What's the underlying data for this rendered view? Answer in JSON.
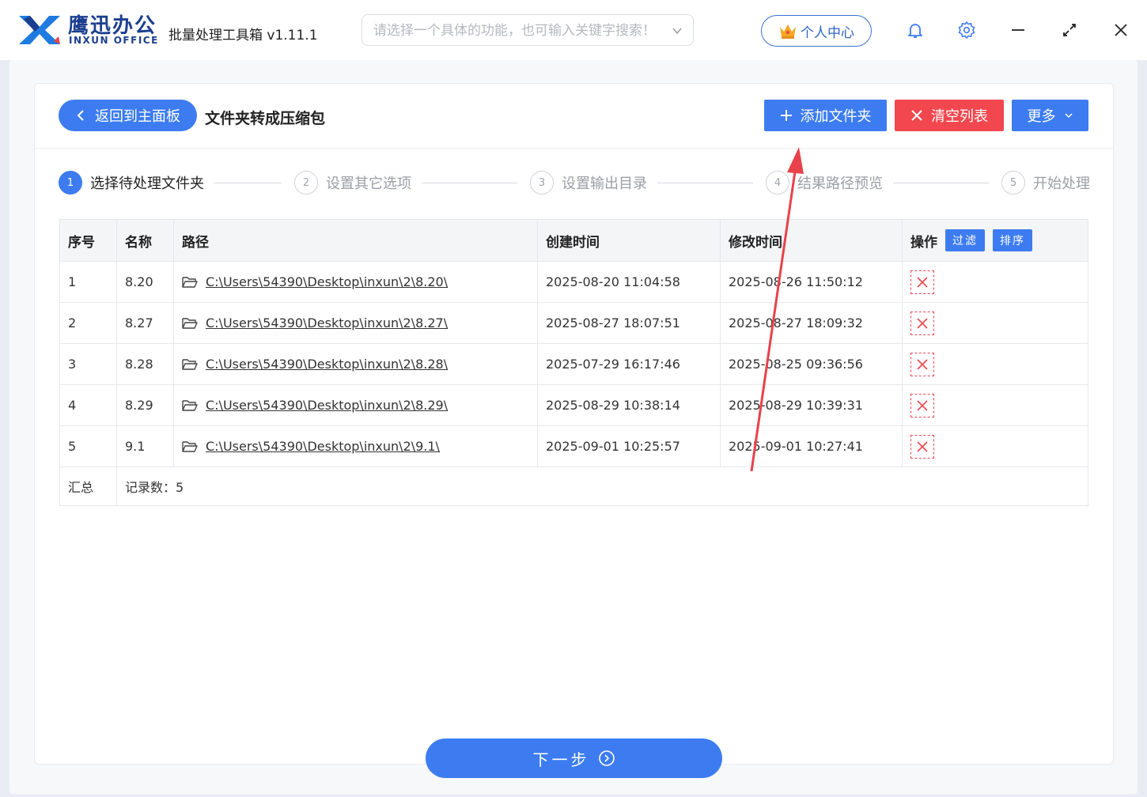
{
  "brand": {
    "name_cn": "鹰迅办公",
    "name_en": "INXUN OFFICE"
  },
  "app": {
    "title": "批量处理工具箱 v1.11.1"
  },
  "search": {
    "placeholder": "请选择一个具体的功能，也可输入关键字搜索！"
  },
  "header": {
    "user_center_label": "个人中心"
  },
  "toolbar": {
    "back_label": "返回到主面板",
    "page_title": "文件夹转成压缩包",
    "add_folder_label": "添加文件夹",
    "clear_list_label": "清空列表",
    "more_label": "更多"
  },
  "steps": [
    {
      "num": "1",
      "label": "选择待处理文件夹"
    },
    {
      "num": "2",
      "label": "设置其它选项"
    },
    {
      "num": "3",
      "label": "设置输出目录"
    },
    {
      "num": "4",
      "label": "结果路径预览"
    },
    {
      "num": "5",
      "label": "开始处理"
    }
  ],
  "table": {
    "headers": {
      "no": "序号",
      "name": "名称",
      "path": "路径",
      "created": "创建时间",
      "modified": "修改时间",
      "op": "操作",
      "filter": "过滤",
      "sort": "排序"
    },
    "rows": [
      {
        "no": "1",
        "name": "8.20",
        "path": "C:\\Users\\54390\\Desktop\\inxun\\2\\8.20\\",
        "created": "2025-08-20 11:04:58",
        "modified": "2025-08-26 11:50:12"
      },
      {
        "no": "2",
        "name": "8.27",
        "path": "C:\\Users\\54390\\Desktop\\inxun\\2\\8.27\\",
        "created": "2025-08-27 18:07:51",
        "modified": "2025-08-27 18:09:32"
      },
      {
        "no": "3",
        "name": "8.28",
        "path": "C:\\Users\\54390\\Desktop\\inxun\\2\\8.28\\",
        "created": "2025-07-29 16:17:46",
        "modified": "2025-08-25 09:36:56"
      },
      {
        "no": "4",
        "name": "8.29",
        "path": "C:\\Users\\54390\\Desktop\\inxun\\2\\8.29\\",
        "created": "2025-08-29 10:38:14",
        "modified": "2025-08-29 10:39:31"
      },
      {
        "no": "5",
        "name": "9.1",
        "path": "C:\\Users\\54390\\Desktop\\inxun\\2\\9.1\\",
        "created": "2025-09-01 10:25:57",
        "modified": "2025-09-01 10:27:41"
      }
    ],
    "summary_label": "汇总",
    "summary_value": "记录数：5"
  },
  "footer": {
    "next_label": "下一步"
  },
  "colors": {
    "primary": "#3d7cf0",
    "danger": "#f2474f",
    "brand": "#1b3f8f",
    "annotation": "#e8424a"
  }
}
